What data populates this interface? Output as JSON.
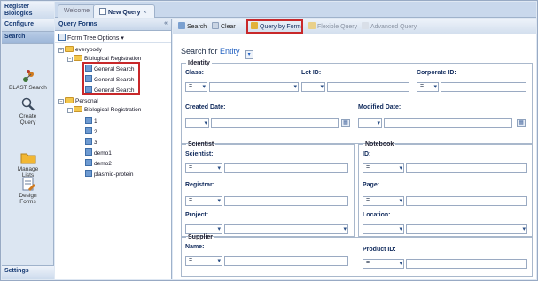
{
  "nav": {
    "register": "Register Biologics",
    "configure": "Configure",
    "search": "Search",
    "tools": [
      {
        "label": "BLAST Search",
        "icon": "dna-icon"
      },
      {
        "label": "Create Query",
        "icon": "magnifier-icon"
      },
      {
        "label": "Manage Lists",
        "icon": "folder-icon"
      },
      {
        "label": "Design Forms",
        "icon": "form-edit-icon"
      }
    ],
    "settings": "Settings"
  },
  "tabs": [
    {
      "label": "Welcome",
      "active": false
    },
    {
      "label": "New Query",
      "active": true
    }
  ],
  "query_forms": {
    "title": "Query Forms",
    "collapse": "«",
    "options_label": "Form Tree Options",
    "tree": {
      "everybody": "everybody",
      "bio_reg_1": "Biological Registration",
      "general_search_1": "General Search",
      "general_search_2": "General Search",
      "general_search_3": "General Search",
      "personal": "Personal",
      "bio_reg_2": "Biological Registration",
      "item_1": "1",
      "item_2": "2",
      "item_3": "3",
      "demo1": "demo1",
      "demo2": "demo2",
      "plasmid": "plasmid-protein"
    }
  },
  "toolbar": {
    "search": "Search",
    "clear": "Clear",
    "query_by_form": "Query by Form",
    "flexible_query": "Flexible Query",
    "advanced_query": "Advanced Query"
  },
  "search_for": {
    "prefix": "Search for",
    "value": "Entity"
  },
  "form": {
    "identity": {
      "legend": "Identity",
      "class": "Class:",
      "lot_id": "Lot ID:",
      "corporate_id": "Corporate ID:",
      "created_date": "Created Date:",
      "modified_date": "Modified Date:",
      "eq": "="
    },
    "scientist": {
      "legend": "Scientist",
      "scientist": "Scientist:",
      "registrar": "Registrar:",
      "project": "Project:",
      "eq": "="
    },
    "notebook": {
      "legend": "Notebook",
      "id": "ID:",
      "page": "Page:",
      "location": "Location:",
      "eq": "="
    },
    "supplier": {
      "legend": "Supplier",
      "name": "Name:",
      "product_id": "Product ID:",
      "eq": "="
    }
  },
  "colors": {
    "highlight": "#c8282a",
    "link_blue": "#1f5fc0"
  }
}
